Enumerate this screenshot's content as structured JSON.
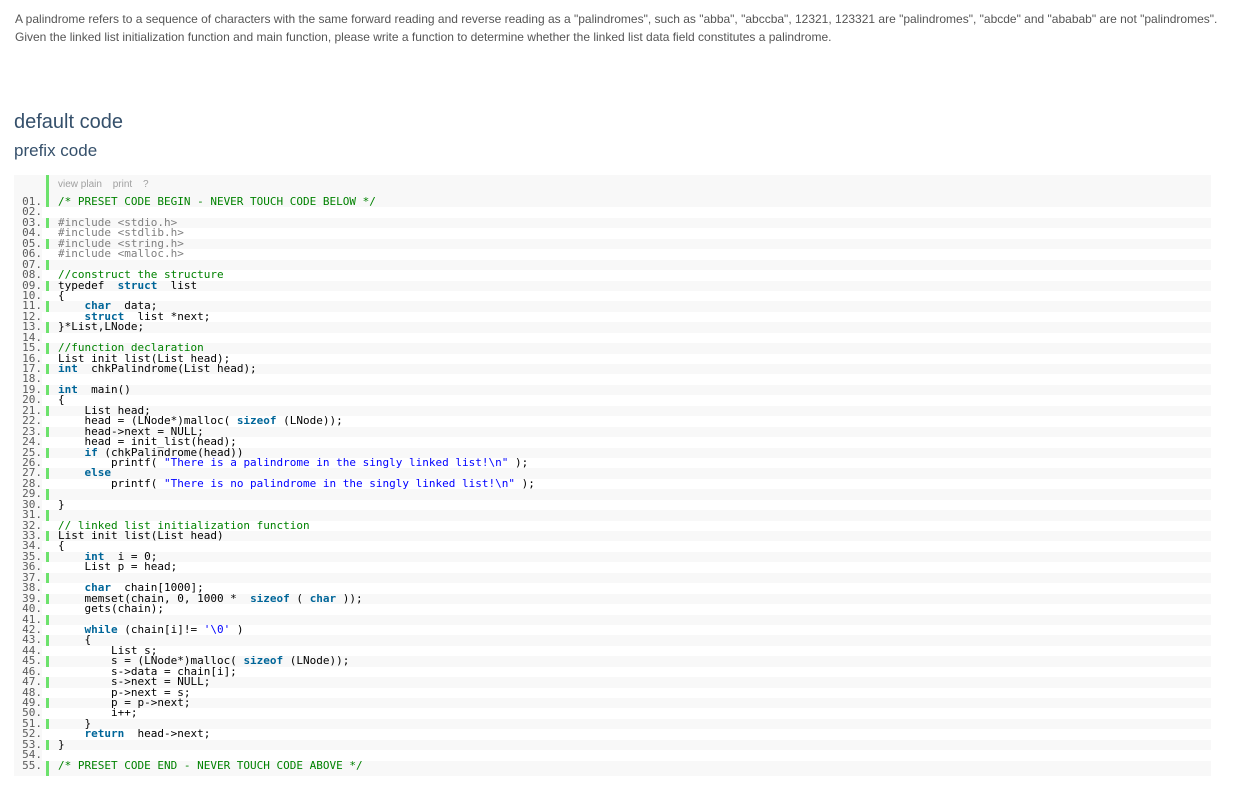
{
  "problem": {
    "line1": "A palindrome refers to a sequence of characters with the same forward reading and reverse reading as a \"palindromes\", such as \"abba\", \"abccba\", 12321, 123321 are \"palindromes\", \"abcde\" and \"ababab\" are not \"palindromes\".",
    "line2": "Given the linked list initialization function and main function, please write a function to determine whether the linked list data field constitutes a palindrome."
  },
  "sections": {
    "default_code": "default code",
    "prefix_code": "prefix code"
  },
  "toolbar": {
    "view_plain": "view plain",
    "print": "print",
    "help": "?"
  },
  "code_lines": [
    {
      "n": "01.",
      "tokens": [
        [
          "c",
          "/* PRESET CODE BEGIN - NEVER TOUCH CODE BELOW */"
        ]
      ]
    },
    {
      "n": "02.",
      "tokens": []
    },
    {
      "n": "03.",
      "tokens": [
        [
          "d",
          "#include <stdio.h>"
        ]
      ]
    },
    {
      "n": "04.",
      "tokens": [
        [
          "d",
          "#include <stdlib.h>"
        ]
      ]
    },
    {
      "n": "05.",
      "tokens": [
        [
          "d",
          "#include <string.h>"
        ]
      ]
    },
    {
      "n": "06.",
      "tokens": [
        [
          "d",
          "#include <malloc.h>"
        ]
      ]
    },
    {
      "n": "07.",
      "tokens": []
    },
    {
      "n": "08.",
      "tokens": [
        [
          "c",
          "//construct the structure"
        ]
      ]
    },
    {
      "n": "09.",
      "tokens": [
        [
          "p",
          "typedef  "
        ],
        [
          "k",
          "struct"
        ],
        [
          "p",
          "  list"
        ]
      ]
    },
    {
      "n": "10.",
      "tokens": [
        [
          "p",
          "{"
        ]
      ]
    },
    {
      "n": "11.",
      "tokens": [
        [
          "p",
          "    "
        ],
        [
          "k",
          "char"
        ],
        [
          "p",
          "  data;"
        ]
      ]
    },
    {
      "n": "12.",
      "tokens": [
        [
          "p",
          "    "
        ],
        [
          "k",
          "struct"
        ],
        [
          "p",
          "  list *next;"
        ]
      ]
    },
    {
      "n": "13.",
      "tokens": [
        [
          "p",
          "}*List,LNode;"
        ]
      ]
    },
    {
      "n": "14.",
      "tokens": []
    },
    {
      "n": "15.",
      "tokens": [
        [
          "c",
          "//function declaration"
        ]
      ]
    },
    {
      "n": "16.",
      "tokens": [
        [
          "p",
          "List init_list(List head);"
        ]
      ]
    },
    {
      "n": "17.",
      "tokens": [
        [
          "k",
          "int"
        ],
        [
          "p",
          "  chkPalindrome(List head);"
        ]
      ]
    },
    {
      "n": "18.",
      "tokens": []
    },
    {
      "n": "19.",
      "tokens": [
        [
          "k",
          "int"
        ],
        [
          "p",
          "  main()"
        ]
      ]
    },
    {
      "n": "20.",
      "tokens": [
        [
          "p",
          "{"
        ]
      ]
    },
    {
      "n": "21.",
      "tokens": [
        [
          "p",
          "    List head;"
        ]
      ]
    },
    {
      "n": "22.",
      "tokens": [
        [
          "p",
          "    head = (LNode*)malloc( "
        ],
        [
          "k",
          "sizeof"
        ],
        [
          "p",
          " (LNode));"
        ]
      ]
    },
    {
      "n": "23.",
      "tokens": [
        [
          "p",
          "    head->next = NULL;"
        ]
      ]
    },
    {
      "n": "24.",
      "tokens": [
        [
          "p",
          "    head = init_list(head);"
        ]
      ]
    },
    {
      "n": "25.",
      "tokens": [
        [
          "p",
          "    "
        ],
        [
          "k",
          "if"
        ],
        [
          "p",
          " (chkPalindrome(head))"
        ]
      ]
    },
    {
      "n": "26.",
      "tokens": [
        [
          "p",
          "        printf( "
        ],
        [
          "s",
          "\"There is a palindrome in the singly linked list!\\n\""
        ],
        [
          "p",
          " );"
        ]
      ]
    },
    {
      "n": "27.",
      "tokens": [
        [
          "p",
          "    "
        ],
        [
          "k",
          "else"
        ]
      ]
    },
    {
      "n": "28.",
      "tokens": [
        [
          "p",
          "        printf( "
        ],
        [
          "s",
          "\"There is no palindrome in the singly linked list!\\n\""
        ],
        [
          "p",
          " );"
        ]
      ]
    },
    {
      "n": "29.",
      "tokens": []
    },
    {
      "n": "30.",
      "tokens": [
        [
          "p",
          "}"
        ]
      ]
    },
    {
      "n": "31.",
      "tokens": []
    },
    {
      "n": "32.",
      "tokens": [
        [
          "c",
          "// linked list initialization function"
        ]
      ]
    },
    {
      "n": "33.",
      "tokens": [
        [
          "p",
          "List init_list(List head)"
        ]
      ]
    },
    {
      "n": "34.",
      "tokens": [
        [
          "p",
          "{"
        ]
      ]
    },
    {
      "n": "35.",
      "tokens": [
        [
          "p",
          "    "
        ],
        [
          "k",
          "int"
        ],
        [
          "p",
          "  i = 0;"
        ]
      ]
    },
    {
      "n": "36.",
      "tokens": [
        [
          "p",
          "    List p = head;"
        ]
      ]
    },
    {
      "n": "37.",
      "tokens": []
    },
    {
      "n": "38.",
      "tokens": [
        [
          "p",
          "    "
        ],
        [
          "k",
          "char"
        ],
        [
          "p",
          "  chain[1000];"
        ]
      ]
    },
    {
      "n": "39.",
      "tokens": [
        [
          "p",
          "    memset(chain, 0, 1000 *  "
        ],
        [
          "k",
          "sizeof"
        ],
        [
          "p",
          " ( "
        ],
        [
          "k",
          "char"
        ],
        [
          "p",
          " ));"
        ]
      ]
    },
    {
      "n": "40.",
      "tokens": [
        [
          "p",
          "    gets(chain);"
        ]
      ]
    },
    {
      "n": "41.",
      "tokens": []
    },
    {
      "n": "42.",
      "tokens": [
        [
          "p",
          "    "
        ],
        [
          "k",
          "while"
        ],
        [
          "p",
          " (chain[i]!= "
        ],
        [
          "s",
          "'\\0'"
        ],
        [
          "p",
          " )"
        ]
      ]
    },
    {
      "n": "43.",
      "tokens": [
        [
          "p",
          "    {"
        ]
      ]
    },
    {
      "n": "44.",
      "tokens": [
        [
          "p",
          "        List s;"
        ]
      ]
    },
    {
      "n": "45.",
      "tokens": [
        [
          "p",
          "        s = (LNode*)malloc( "
        ],
        [
          "k",
          "sizeof"
        ],
        [
          "p",
          " (LNode));"
        ]
      ]
    },
    {
      "n": "46.",
      "tokens": [
        [
          "p",
          "        s->data = chain[i];"
        ]
      ]
    },
    {
      "n": "47.",
      "tokens": [
        [
          "p",
          "        s->next = NULL;"
        ]
      ]
    },
    {
      "n": "48.",
      "tokens": [
        [
          "p",
          "        p->next = s;"
        ]
      ]
    },
    {
      "n": "49.",
      "tokens": [
        [
          "p",
          "        p = p->next;"
        ]
      ]
    },
    {
      "n": "50.",
      "tokens": [
        [
          "p",
          "        i++;"
        ]
      ]
    },
    {
      "n": "51.",
      "tokens": [
        [
          "p",
          "    }"
        ]
      ]
    },
    {
      "n": "52.",
      "tokens": [
        [
          "p",
          "    "
        ],
        [
          "k",
          "return"
        ],
        [
          "p",
          "  head->next;"
        ]
      ]
    },
    {
      "n": "53.",
      "tokens": [
        [
          "p",
          "}"
        ]
      ]
    },
    {
      "n": "54.",
      "tokens": []
    },
    {
      "n": "55.",
      "tokens": [
        [
          "c",
          "/* PRESET CODE END - NEVER TOUCH CODE ABOVE */"
        ]
      ]
    }
  ]
}
